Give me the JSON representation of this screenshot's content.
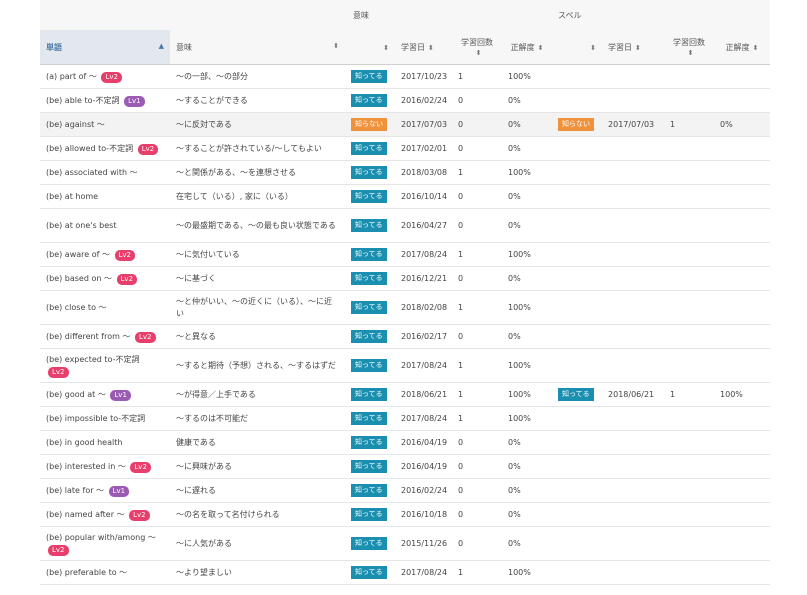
{
  "header": {
    "group_meaning": "意味",
    "group_spell": "スペル",
    "col_word": "単語",
    "col_meaning": "意味",
    "col_date": "学習日",
    "col_count": "学習回数",
    "col_acc": "正解度",
    "sort_glyph": "⬍",
    "sort_up": "▲"
  },
  "colors": {
    "known": "#1a8fb0",
    "unknown": "#f0923c",
    "lv2": "#e83e6c",
    "lv1": "#9b5bb5",
    "word_header_bg": "#e3e8ee"
  },
  "rows": [
    {
      "word": "(a) part of ～",
      "lv": "Lv2",
      "meaning": "～の一部、～の部分",
      "status": "知ってる",
      "date": "2017/10/23",
      "count": "1",
      "acc": "100%"
    },
    {
      "word": "(be) able to-不定詞",
      "lv": "Lv1",
      "meaning": "～することができる",
      "status": "知ってる",
      "date": "2016/02/24",
      "count": "0",
      "acc": "0%"
    },
    {
      "word": "(be) against ～",
      "lv": "",
      "meaning": "～に反対である",
      "status": "知らない",
      "date": "2017/07/03",
      "count": "0",
      "acc": "0%",
      "spell_status": "知らない",
      "spell_date": "2017/07/03",
      "spell_count": "1",
      "spell_acc": "0%"
    },
    {
      "word": "(be) allowed to-不定詞",
      "lv": "Lv2",
      "meaning": "～することが許されている/～してもよい",
      "status": "知ってる",
      "date": "2017/02/01",
      "count": "0",
      "acc": "0%"
    },
    {
      "word": "(be) associated with ～",
      "lv": "",
      "meaning": "～と関係がある、～を連想させる",
      "status": "知ってる",
      "date": "2018/03/08",
      "count": "1",
      "acc": "100%"
    },
    {
      "word": "(be) at home",
      "lv": "",
      "meaning": "在宅して（いる）, 家に（いる）",
      "status": "知ってる",
      "date": "2016/10/14",
      "count": "0",
      "acc": "0%"
    },
    {
      "word": "(be) at one's best",
      "lv": "",
      "meaning": "～の最盛期である、～の最も良い状態である",
      "status": "知ってる",
      "date": "2016/04/27",
      "count": "0",
      "acc": "0%"
    },
    {
      "word": "(be) aware of ～",
      "lv": "Lv2",
      "meaning": "～に気付いている",
      "status": "知ってる",
      "date": "2017/08/24",
      "count": "1",
      "acc": "100%"
    },
    {
      "word": "(be) based on ～",
      "lv": "Lv2",
      "meaning": "～に基づく",
      "status": "知ってる",
      "date": "2016/12/21",
      "count": "0",
      "acc": "0%"
    },
    {
      "word": "(be) close to ～",
      "lv": "",
      "meaning": "～と仲がいい、～の近くに（いる）、～に近い",
      "status": "知ってる",
      "date": "2018/02/08",
      "count": "1",
      "acc": "100%"
    },
    {
      "word": "(be) different from ～",
      "lv": "Lv2",
      "meaning": "～と異なる",
      "status": "知ってる",
      "date": "2016/02/17",
      "count": "0",
      "acc": "0%"
    },
    {
      "word": "(be) expected to-不定詞",
      "lv": "Lv2",
      "meaning": "～すると期待（予想）される、～するはずだ",
      "status": "知ってる",
      "date": "2017/08/24",
      "count": "1",
      "acc": "100%"
    },
    {
      "word": "(be) good at ～",
      "lv": "Lv1",
      "meaning": "～が得意／上手である",
      "status": "知ってる",
      "date": "2018/06/21",
      "count": "1",
      "acc": "100%",
      "spell_status": "知ってる",
      "spell_date": "2018/06/21",
      "spell_count": "1",
      "spell_acc": "100%"
    },
    {
      "word": "(be) impossible to-不定詞",
      "lv": "",
      "meaning": "～するのは不可能だ",
      "status": "知ってる",
      "date": "2017/08/24",
      "count": "1",
      "acc": "100%"
    },
    {
      "word": "(be) in good health",
      "lv": "",
      "meaning": "健康である",
      "status": "知ってる",
      "date": "2016/04/19",
      "count": "0",
      "acc": "0%"
    },
    {
      "word": "(be) interested in ～",
      "lv": "Lv2",
      "meaning": "～に興味がある",
      "status": "知ってる",
      "date": "2016/04/19",
      "count": "0",
      "acc": "0%"
    },
    {
      "word": "(be) late for ～",
      "lv": "Lv1",
      "meaning": "～に遅れる",
      "status": "知ってる",
      "date": "2016/02/24",
      "count": "0",
      "acc": "0%"
    },
    {
      "word": "(be) named after ～",
      "lv": "Lv2",
      "meaning": "～の名を取って名付けられる",
      "status": "知ってる",
      "date": "2016/10/18",
      "count": "0",
      "acc": "0%"
    },
    {
      "word": "(be) popular with/among ～",
      "lv": "Lv2",
      "meaning": "～に人気がある",
      "status": "知ってる",
      "date": "2015/11/26",
      "count": "0",
      "acc": "0%"
    },
    {
      "word": "(be) preferable to ～",
      "lv": "",
      "meaning": "～より望ましい",
      "status": "知ってる",
      "date": "2017/08/24",
      "count": "1",
      "acc": "100%"
    }
  ]
}
